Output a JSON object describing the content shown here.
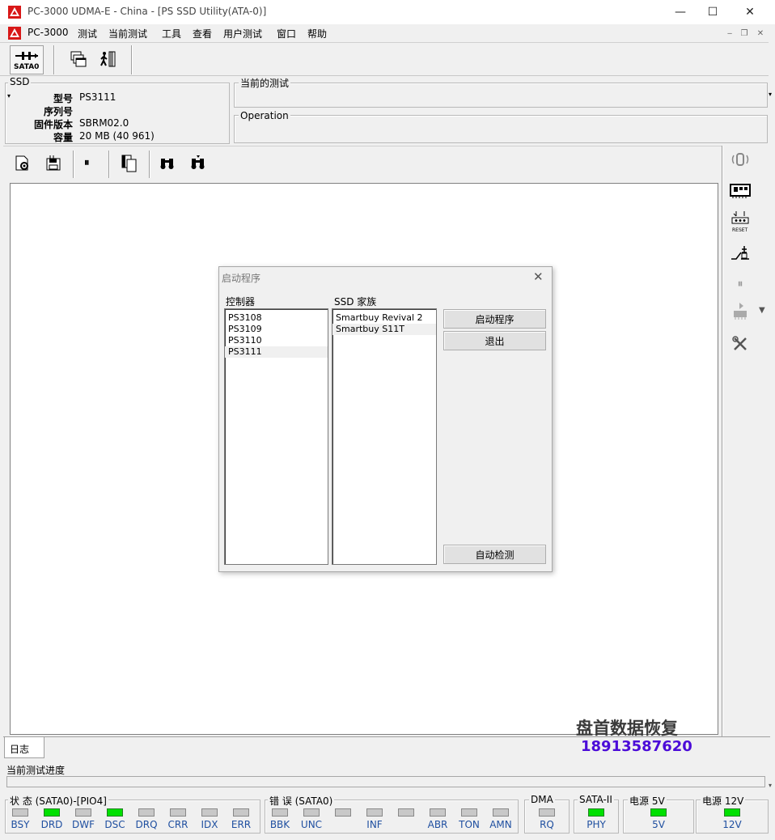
{
  "window": {
    "title": "PC-3000 UDMA-E - China - [PS SSD Utility(ATA-0)]",
    "controls": [
      "—",
      "☐",
      "✕"
    ]
  },
  "menu": {
    "items": [
      "PC-3000",
      "测试",
      "当前测试",
      "工具",
      "查看",
      "用户测试",
      "窗口",
      "帮助"
    ],
    "mdi_controls": [
      "‒",
      "❐",
      "✕"
    ]
  },
  "toolbar": {
    "sata_label": "SATA0"
  },
  "ssd": {
    "group_label": "SSD",
    "model_label": "型号",
    "model_value": "PS3111",
    "serial_label": "序列号",
    "serial_value": "",
    "firmware_label": "固件版本",
    "firmware_value": "SBRM02.0",
    "capacity_label": "容量",
    "capacity_value": "20 MB (40 961)"
  },
  "current_test": {
    "label": "当前的测试"
  },
  "operation": {
    "label": "Operation"
  },
  "dialog": {
    "title": "启动程序",
    "controller_header": "控制器",
    "controllers": [
      "PS3108",
      "PS3109",
      "PS3110",
      "PS3111"
    ],
    "family_header": "SSD 家族",
    "families": [
      "Smartbuy Revival 2",
      "Smartbuy S11T"
    ],
    "start_button": "启动程序",
    "exit_button": "退出",
    "autodetect_button": "自动检测"
  },
  "log_tab": "日志",
  "progress": {
    "label": "当前测试进度"
  },
  "watermark": {
    "line1": "盘首数据恢复",
    "line2": "18913587620"
  },
  "status": {
    "state_group": "状 态 (SATA0)-[PIO4]",
    "state_leds": [
      {
        "name": "BSY",
        "on": false
      },
      {
        "name": "DRD",
        "on": true
      },
      {
        "name": "DWF",
        "on": false
      },
      {
        "name": "DSC",
        "on": true
      },
      {
        "name": "DRQ",
        "on": false
      },
      {
        "name": "CRR",
        "on": false
      },
      {
        "name": "IDX",
        "on": false
      },
      {
        "name": "ERR",
        "on": false
      }
    ],
    "error_group": "错 误 (SATA0)",
    "error_leds": [
      {
        "name": "BBK",
        "on": false
      },
      {
        "name": "UNC",
        "on": false
      },
      {
        "name": "",
        "on": false
      },
      {
        "name": "INF",
        "on": false
      },
      {
        "name": "",
        "on": false
      },
      {
        "name": "ABR",
        "on": false
      },
      {
        "name": "TON",
        "on": false
      },
      {
        "name": "AMN",
        "on": false
      }
    ],
    "dma_group": "DMA",
    "dma_led": {
      "name": "RQ",
      "on": false
    },
    "sata_group": "SATA-II",
    "sata_led": {
      "name": "PHY",
      "on": true
    },
    "p5_group": "电源 5V",
    "p5_led": {
      "name": "5V",
      "on": true
    },
    "p12_group": "电源 12V",
    "p12_led": {
      "name": "12V",
      "on": true
    }
  },
  "colors": {
    "led_on": "#00e000",
    "led_off": "#c8c8c8",
    "watermark": "#3a3a3a",
    "watermark_phone": "#4b0bd8",
    "status_label": "#1f4fa0"
  }
}
